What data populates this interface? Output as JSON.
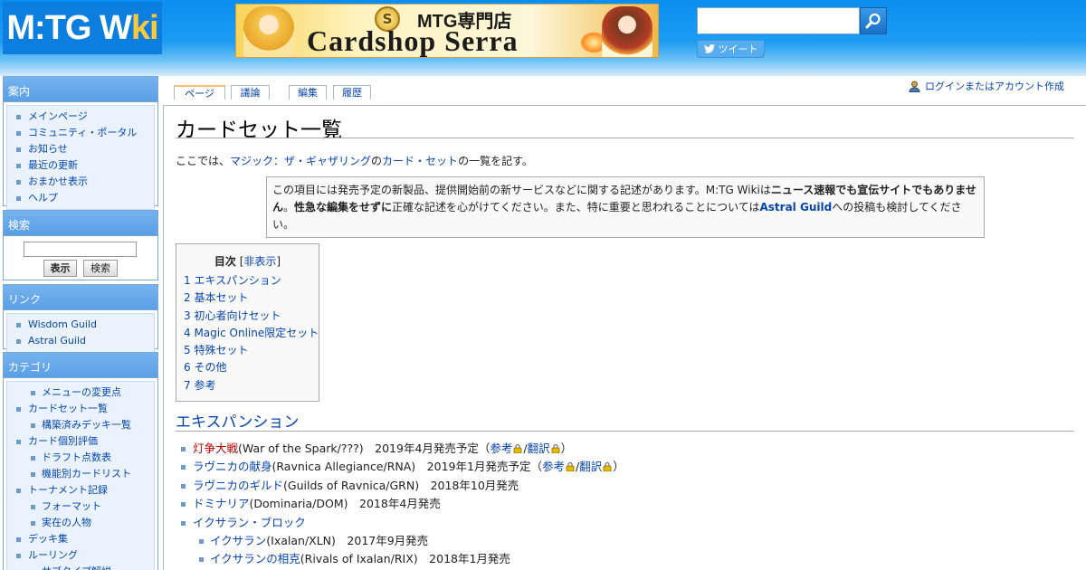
{
  "header": {
    "logo": {
      "m": "M:TG W",
      "ki": "ki"
    },
    "banner": {
      "top": "MTG専門店",
      "main": "Cardshop Serra",
      "coin": "S"
    },
    "search": {
      "placeholder": ""
    },
    "tweet_label": "ツイート"
  },
  "sidebar": {
    "nav": {
      "title": "案内",
      "items": [
        "メインページ",
        "コミュニティ・ポータル",
        "お知らせ",
        "最近の更新",
        "おまかせ表示",
        "ヘルプ"
      ]
    },
    "search": {
      "title": "検索",
      "show_label": "表示",
      "search_label": "検索"
    },
    "links": {
      "title": "リンク",
      "items": [
        "Wisdom Guild",
        "Astral Guild"
      ]
    },
    "categories": {
      "title": "カテゴリ",
      "items": [
        {
          "label": "メニューの変更点",
          "sub": true
        },
        {
          "label": "カードセット一覧",
          "sub": false
        },
        {
          "label": "構築済みデッキ一覧",
          "sub": true
        },
        {
          "label": "カード個別評価",
          "sub": false
        },
        {
          "label": "ドラフト点数表",
          "sub": true
        },
        {
          "label": "機能別カードリスト",
          "sub": true
        },
        {
          "label": "トーナメント記録",
          "sub": false
        },
        {
          "label": "フォーマット",
          "sub": true
        },
        {
          "label": "実在の人物",
          "sub": true
        },
        {
          "label": "デッキ集",
          "sub": false
        },
        {
          "label": "ルーリング",
          "sub": false
        },
        {
          "label": "サブタイプ解説",
          "sub": true
        }
      ]
    }
  },
  "tabs": {
    "page": "ページ",
    "talk": "議論",
    "edit": "編集",
    "history": "履歴"
  },
  "login": "ログインまたはアカウント作成",
  "page": {
    "title": "カードセット一覧",
    "intro": {
      "pre": "ここでは、",
      "link1": "マジック：ザ・ギャザリング",
      "mid": "の",
      "link2": "カード・セット",
      "post": "の一覧を記す。"
    },
    "notice": {
      "t1": "この項目には発売予定の新製品、提供開始前の新サービスなどに関する記述があります。M:TG Wikiは",
      "b1": "ニュース速報でも宣伝サイトでもありません",
      "t2": "。",
      "b2": "性急な編集をせずに",
      "t3": "正確な記述を心がけてください。また、特に重要と思われることについては",
      "link": "Astral Guild",
      "t4": "への投稿も検討してください。"
    },
    "toc": {
      "title": "目次",
      "toggle": "非表示",
      "items": [
        "1 エキスパンション",
        "2 基本セット",
        "3 初心者向けセット",
        "4 Magic Online限定セット",
        "5 特殊セット",
        "6 その他",
        "7 参考"
      ]
    },
    "section": "エキスパンション",
    "expansions": [
      {
        "link": "灯争大戦",
        "red": true,
        "rest": "(War of the Spark/???)　2019年4月発売予定（",
        "ref": "参考",
        "trans": "翻訳",
        "end": "）",
        "sub": false
      },
      {
        "link": "ラヴニカの献身",
        "red": false,
        "rest": "(Ravnica Allegiance/RNA)　2019年1月発売予定（",
        "ref": "参考",
        "trans": "翻訳",
        "end": "）",
        "sub": false
      },
      {
        "link": "ラヴニカのギルド",
        "red": false,
        "rest": "(Guilds of Ravnica/GRN)　2018年10月発売",
        "sub": false
      },
      {
        "link": "ドミナリア",
        "red": false,
        "rest": "(Dominaria/DOM)　2018年4月発売",
        "sub": false
      },
      {
        "link": "イクサラン・ブロック",
        "red": false,
        "rest": "",
        "sub": false
      },
      {
        "link": "イクサラン",
        "red": false,
        "rest": "(Ixalan/XLN)　2017年9月発売",
        "sub": true
      },
      {
        "link": "イクサランの相克",
        "red": false,
        "rest": "(Rivals of Ixalan/RIX)　2018年1月発売",
        "sub": true
      }
    ]
  },
  "colors": {
    "link": "#0645ad",
    "redlink": "#ba0000",
    "header": "#0a8ef0",
    "bullet": "#6d98c8"
  }
}
